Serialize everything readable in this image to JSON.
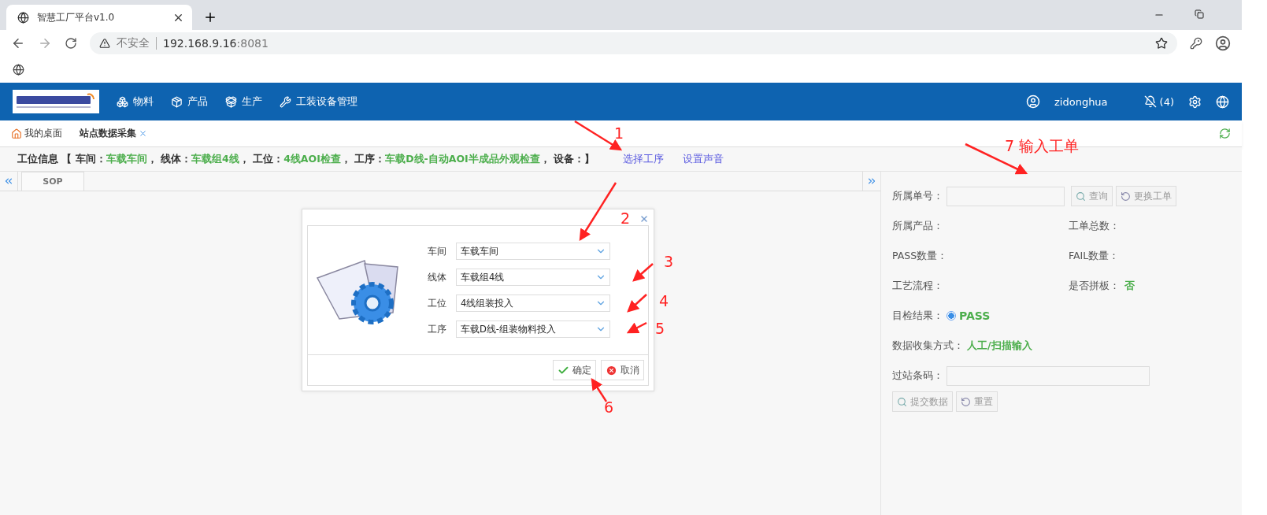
{
  "browser": {
    "tab_title": "智慧工厂平台v1.0",
    "security": "不安全",
    "url_host": "192.168.9.16",
    "url_port": ":8081"
  },
  "header": {
    "menu": [
      "物料",
      "产品",
      "生产",
      "工装设备管理"
    ],
    "user": "zidonghua",
    "notifications": "(4)"
  },
  "page_tabs": [
    {
      "label": "我的桌面",
      "selected": false,
      "closable": false
    },
    {
      "label": "站点数据采集",
      "selected": true,
      "closable": true
    }
  ],
  "info_bar": {
    "label": "工位信息",
    "open": "【",
    "separator": "，",
    "fields": [
      {
        "name": "车间：",
        "value": "车载车间"
      },
      {
        "name": "线体：",
        "value": "车载组4线"
      },
      {
        "name": "工位：",
        "value": "4线AOI检查"
      },
      {
        "name": "工序：",
        "value": "车载D线-自动AOI半成品外观检查"
      },
      {
        "name": "设备："
      }
    ],
    "close": "】",
    "links": [
      "选择工序",
      "设置声音"
    ]
  },
  "left_panel": {
    "tab": "SOP"
  },
  "dialog": {
    "fields": [
      {
        "label": "车间",
        "value": "车载车间"
      },
      {
        "label": "线体",
        "value": "车载组4线"
      },
      {
        "label": "工位",
        "value": "4线组装投入"
      },
      {
        "label": "工序",
        "value": "车载D线-组装物料投入"
      }
    ],
    "ok": "确定",
    "cancel": "取消"
  },
  "right_panel": {
    "order_label": "所属单号：",
    "query": "查询",
    "change": "更换工单",
    "pairs": [
      [
        {
          "label": "所属产品："
        },
        {
          "label": "工单总数："
        }
      ],
      [
        {
          "label": "PASS数量："
        },
        {
          "label": "FAIL数量："
        }
      ],
      [
        {
          "label": "工艺流程："
        },
        {
          "label": "是否拼板：",
          "value": "否"
        }
      ]
    ],
    "check_label": "目检结果：",
    "check_option": {
      "label": "PASS",
      "selected": true
    },
    "method_label": "数据收集方式：",
    "method_value": "人工/扫描输入",
    "barcode_label": "过站条码：",
    "submit": "提交数据",
    "reset": "重置"
  },
  "annotations": [
    {
      "text": "1"
    },
    {
      "text": "7 输入工单"
    },
    {
      "text": "2"
    },
    {
      "text": "3"
    },
    {
      "text": "4"
    },
    {
      "text": "5"
    },
    {
      "text": "6"
    }
  ]
}
